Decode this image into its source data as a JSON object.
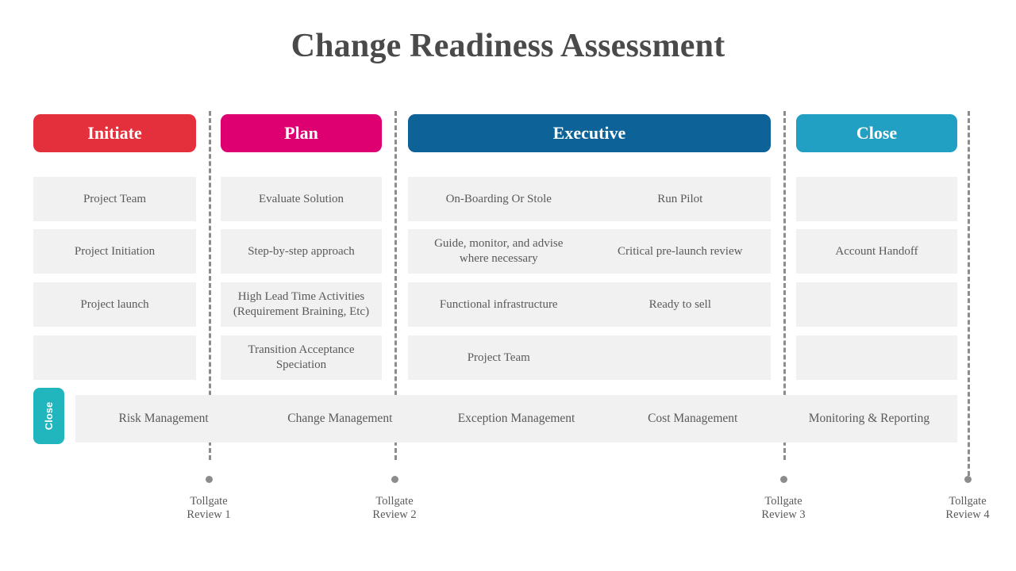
{
  "slide": {
    "title": "Change Readiness Assessment",
    "background_color": "#ffffff"
  },
  "phases": [
    {
      "id": "initiate",
      "label": "Initiate",
      "color": "#e3303c",
      "rows": [
        "Project Team",
        "Project Initiation",
        "Project launch",
        ""
      ]
    },
    {
      "id": "plan",
      "label": "Plan",
      "color": "#de0071",
      "rows": [
        "Evaluate Solution",
        "Step-by-step approach",
        "High Lead Time Activities\n(Requirement Braining, Etc)",
        "Transition Acceptance\nSpeciation"
      ]
    },
    {
      "id": "executive",
      "label": "Executive",
      "color": "#0d6398",
      "rows_left": [
        "On-Boarding Or Stole",
        "Guide, monitor, and advise\nwhere necessary",
        "Functional infrastructure",
        "Project Team"
      ],
      "rows_right": [
        "Run Pilot",
        "Critical pre-launch review",
        "Ready to sell",
        ""
      ]
    },
    {
      "id": "close",
      "label": "Close",
      "color": "#22a0c4",
      "rows": [
        "",
        "Account Handoff",
        "",
        ""
      ]
    }
  ],
  "management_band": {
    "tab_label": "Close",
    "tab_color": "#21b5bd",
    "items": [
      "Risk  Management",
      "Change Management",
      "Exception Management",
      "Cost Management",
      "Monitoring & Reporting"
    ]
  },
  "tollgates": [
    {
      "line1": "Tollgate",
      "line2": "Review 1"
    },
    {
      "line1": "Tollgate",
      "line2": "Review 2"
    },
    {
      "line1": "Tollgate",
      "line2": "Review 3"
    },
    {
      "line1": "Tollgate",
      "line2": "Review 4"
    }
  ],
  "dividers": {
    "color": "#8c8c8c"
  }
}
